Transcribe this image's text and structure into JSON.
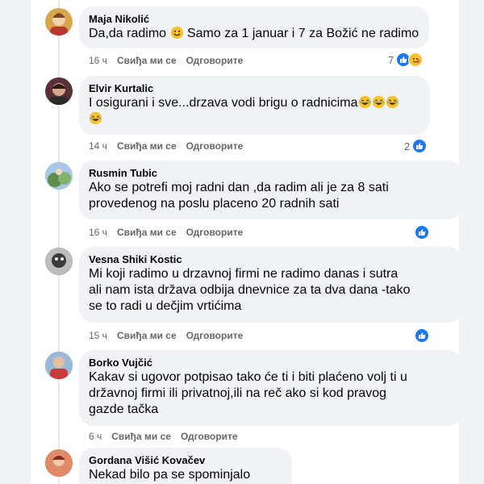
{
  "comments": [
    {
      "author": "Maja Nikolić",
      "text_before": "Da,da radimo ",
      "text_after": " Samo za 1 januar i 7 za Božić ne radimo",
      "time": "16 ч",
      "like_label": "Свиђа ми се",
      "reply_label": "Одговорите",
      "reaction_count": "7",
      "avatar_color": "#d8a64a"
    },
    {
      "author": "Elvir Kurtalic",
      "text_line1": "I osigurani i sve...drzava vodi brigu o radnicima",
      "time": "14 ч",
      "like_label": "Свиђа ми се",
      "reply_label": "Одговорите",
      "reaction_count": "2",
      "avatar_color": "#5a2f3a"
    },
    {
      "author": "Rusmin Tubic",
      "text_line1": "Ako se potrefi moj radni dan ,da radim ali je za 8 sati",
      "text_line2": "provedenog na poslu placeno 20 radnih sati",
      "time": "16 ч",
      "like_label": "Свиђа ми се",
      "reply_label": "Одговорите",
      "avatar_color": "#7fa86a"
    },
    {
      "author": "Vesna Shiki Kostic",
      "text_line1": "Mi koji radimo u drzavnoj firmi ne radimo danas i sutra",
      "text_line2": "ali nam ista država odbija dnevnice za ta dva dana -tako",
      "text_line3": "se to radi u dečjim vrtićima",
      "time": "15 ч",
      "like_label": "Свиђа ми се",
      "reply_label": "Одговорите",
      "avatar_color": "#4a4a4a"
    },
    {
      "author": "Borko Vujčić",
      "text_line1": "Kakav si ugovor potpisao tako će ti i biti plaćeno volj ti u",
      "text_line2": "državnoj firmi ili privatnoj,ili na reč ako si kod pravog",
      "text_line3": "gazde tačka",
      "time": "6 ч",
      "like_label": "Свиђа ми се",
      "reply_label": "Одговорите",
      "avatar_color": "#3f6d9a"
    },
    {
      "author": "Gordana Višić Kovačev",
      "text_line1": "Nekad bilo pa se spominjalo",
      "avatar_color": "#c0563b"
    }
  ],
  "colors": {
    "like_blue": "#1877f2",
    "bubble": "#f0f2f5",
    "meta": "#65676b"
  }
}
